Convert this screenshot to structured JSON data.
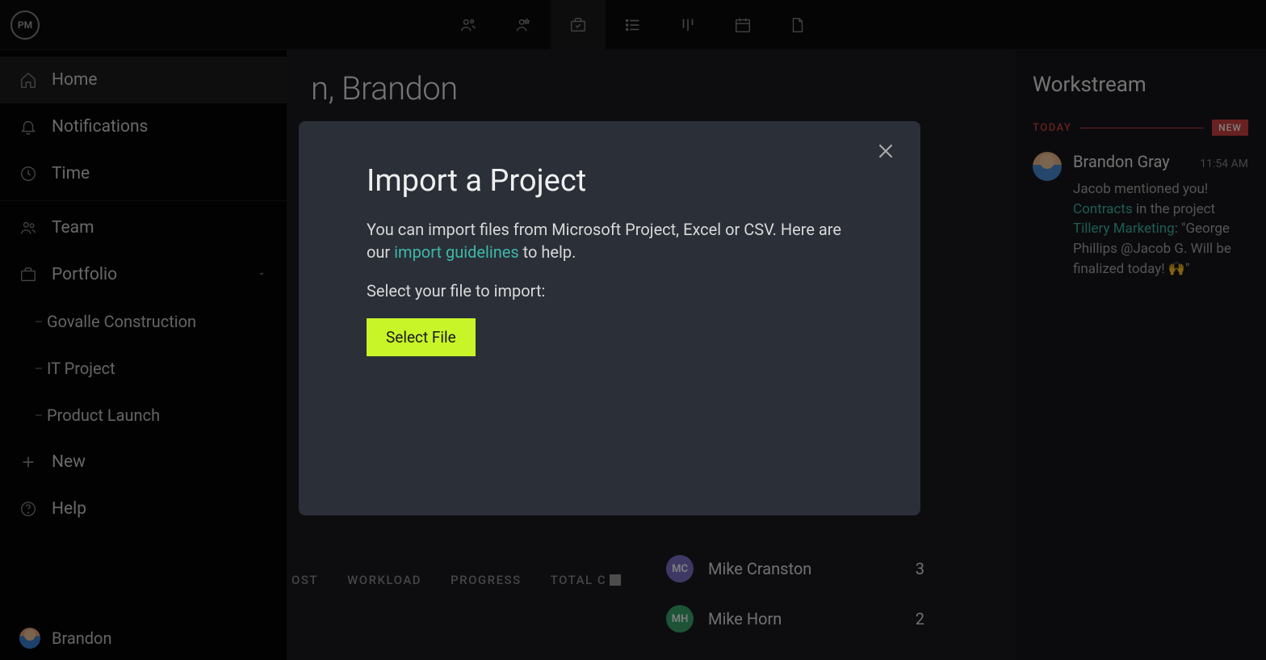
{
  "logo_text": "PM",
  "sidebar": {
    "home": "Home",
    "notifications": "Notifications",
    "time": "Time",
    "team": "Team",
    "portfolio": "Portfolio",
    "portfolio_items": [
      "Govalle Construction",
      "IT Project",
      "Product Launch"
    ],
    "new": "New",
    "help": "Help",
    "user": "Brandon"
  },
  "page_title_fragment": "n, Brandon",
  "bottom_tabs": [
    "OST",
    "WORKLOAD",
    "PROGRESS",
    "TOTAL C"
  ],
  "team_list": [
    {
      "initials": "MC",
      "name": "Mike Cranston",
      "count": "3",
      "color": "#7b72c9"
    },
    {
      "initials": "MH",
      "name": "Mike Horn",
      "count": "2",
      "color": "#3aa66f"
    }
  ],
  "workstream": {
    "title": "Workstream",
    "today_label": "TODAY",
    "new_badge": "NEW",
    "item": {
      "name": "Brandon Gray",
      "time": "11:54 AM",
      "line1": "Jacob mentioned you!",
      "link1": "Contracts",
      "mid1": " in the project ",
      "link2": "Tillery Marketing",
      "tail": ": \"George Phillips @Jacob G. Will be finalized today! 🙌\""
    }
  },
  "modal": {
    "title": "Import a Project",
    "desc_pre": "You can import files from Microsoft Project, Excel or CSV. Here are our ",
    "desc_link": "import guidelines",
    "desc_post": " to help.",
    "select_label": "Select your file to import:",
    "button": "Select File"
  }
}
